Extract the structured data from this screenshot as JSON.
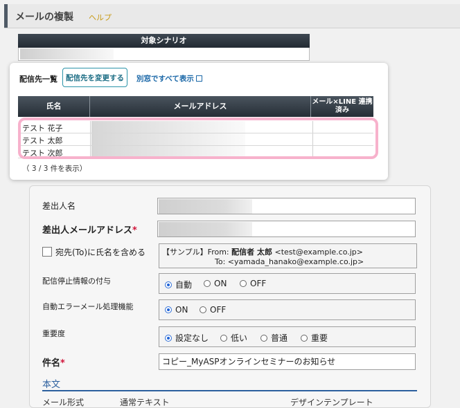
{
  "header": {
    "title": "メールの複製",
    "help": "ヘルプ"
  },
  "scenario": {
    "head": "対象シナリオ"
  },
  "popup": {
    "title": "配信先一覧",
    "change_button": "配信先を変更する",
    "show_all_link": "別窓ですべて表示",
    "columns": {
      "name": "氏名",
      "email": "メールアドレス",
      "line": "メール×LINE 連携済み"
    },
    "rows": [
      {
        "name": "テスト 花子"
      },
      {
        "name": "テスト 太郎"
      },
      {
        "name": "テスト 次郎"
      }
    ],
    "count": "（ 3 / 3 件を表示）"
  },
  "form": {
    "sender_name_label": "差出人名",
    "sender_email_label": "差出人メールアドレス",
    "required_mark": "*",
    "include_name_label": "宛先(To)に氏名を含める",
    "sample": {
      "line1_prefix": "【サンプル】From:",
      "line1_name": "配信者 太郎",
      "line1_addr": "<test@example.co.jp>",
      "line2_prefix": "To:",
      "line2_addr": "<yamada_hanako@example.co.jp>"
    },
    "unsubscribe": {
      "label": "配信停止情報の付与",
      "options": [
        "自動",
        "ON",
        "OFF"
      ],
      "selected": "自動"
    },
    "auto_error": {
      "label": "自動エラーメール処理機能",
      "options": [
        "ON",
        "OFF"
      ],
      "selected": "ON"
    },
    "priority": {
      "label": "重要度",
      "options": [
        "設定なし",
        "低い",
        "普通",
        "重要"
      ],
      "selected": "設定なし"
    },
    "subject": {
      "label": "件名",
      "value": "コピー_MyASPオンラインセミナーのお知らせ"
    },
    "body_section": "本文",
    "cut_left": "メール形式",
    "cut_mid": "通常テキスト",
    "cut_right": "デザインテンプレート"
  }
}
